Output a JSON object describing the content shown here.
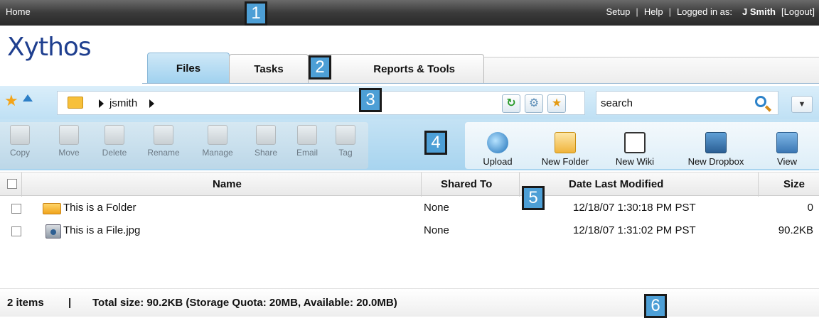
{
  "topbar": {
    "home": "Home",
    "setup": "Setup",
    "help": "Help",
    "logged_in_as": "Logged in as:",
    "user": "J Smith",
    "logout": "[Logout]",
    "separator": "|"
  },
  "logo": "Xythos",
  "tabs": [
    {
      "label": "Files",
      "active": true
    },
    {
      "label": "Tasks",
      "active": false
    },
    {
      "label": "Reports & Tools",
      "active": false
    }
  ],
  "path": {
    "segment": "jsmith"
  },
  "search": {
    "value": "search"
  },
  "toolbar": {
    "disabled": [
      "Copy",
      "Move",
      "Delete",
      "Rename",
      "Manage",
      "Share",
      "Email",
      "Tag"
    ],
    "enabled": [
      "Upload",
      "New Folder",
      "New Wiki",
      "New Dropbox",
      "View"
    ]
  },
  "table": {
    "headers": {
      "name": "Name",
      "shared_to": "Shared To",
      "date_modified": "Date Last Modified",
      "size": "Size"
    },
    "rows": [
      {
        "name": "This is a Folder",
        "type": "folder",
        "shared_to": "None",
        "date": "12/18/07 1:30:18 PM PST",
        "size": "0"
      },
      {
        "name": "This is a File.jpg",
        "type": "file",
        "shared_to": "None",
        "date": "12/18/07 1:31:02 PM PST",
        "size": "90.2KB"
      }
    ]
  },
  "status": {
    "items": "2 items",
    "separator": "|",
    "total": "Total size: 90.2KB (Storage Quota: 20MB, Available: 20.0MB)"
  },
  "callouts": [
    "1",
    "2",
    "3",
    "4",
    "5",
    "6"
  ],
  "colors": {
    "callout": "#4d9fd6",
    "logo": "#1f3f8f",
    "accent_blue": "#bfe0f4"
  }
}
